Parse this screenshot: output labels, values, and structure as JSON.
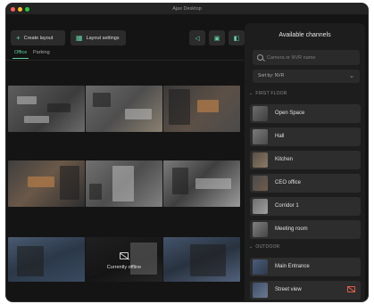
{
  "window": {
    "title": "Ajax Desktop"
  },
  "toolbar": {
    "create_layout_label": "Create layout",
    "layout_settings_label": "Layout settings"
  },
  "tabs": [
    {
      "label": "Office",
      "active": true
    },
    {
      "label": "Parking",
      "active": false
    }
  ],
  "grid": {
    "offline_text": "Currently offline"
  },
  "panel": {
    "title": "Available channels",
    "search_placeholder": "Camera or NVR name",
    "sort_label": "Sort by: NVR",
    "groups": [
      {
        "name": "FIRST FLOOR",
        "items": [
          "Open Space",
          "Hall",
          "Kitchen",
          "CEO office",
          "Corridor 1",
          "Meeting room"
        ]
      },
      {
        "name": "OUTDOOR",
        "items": [
          "Main Entrance",
          "Street view"
        ]
      }
    ]
  },
  "colors": {
    "accent": "#5fd0a0",
    "background": "#141414",
    "panel": "#1d1d1d",
    "offline": "#e05a4a"
  }
}
